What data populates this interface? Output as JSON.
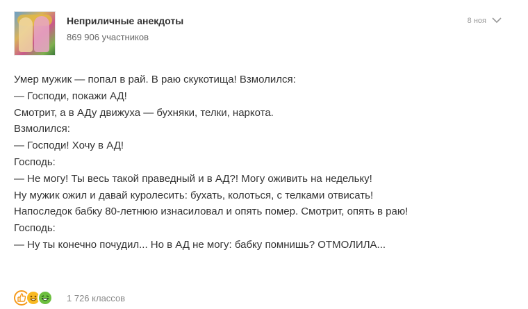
{
  "post": {
    "group_name": "Неприличные анекдоты",
    "members": "869 906 участников",
    "date": "8 ноя",
    "lines": [
      "Умер мужик — попал в рай. В раю скукотища! Взмолился:",
      "— Господи, покажи АД!",
      "Смотрит, а в АДу движуха — бухняки, телки, наркота.",
      "Взмолился:",
      "— Господи! Хочу в АД!",
      "Господь:",
      "— Не могу! Ты весь такой праведный и в АД?! Могу оживить на недельку!",
      "Ну мужик ожил и давай куролесить: бухать, колоться, с телками отвисать!",
      "Напоследок бабку 80-летнюю изнасиловал и опять помер. Смотрит, опять в раю!",
      "Господь:",
      "— Ну ты конечно почудил... Но в АД не могу: бабку помнишь? ОТМОЛИЛА..."
    ],
    "classes_count": "1 726 классов"
  },
  "icons": {
    "menu": "chevron-down-icon",
    "reactions": [
      "like-reaction-icon",
      "laugh-reaction-icon",
      "lol-reaction-icon"
    ]
  },
  "colors": {
    "text": "#333333",
    "muted": "#999999",
    "accent_orange": "#f59a1d",
    "accent_yellow": "#f8b922",
    "accent_green": "#6cbf3f"
  }
}
